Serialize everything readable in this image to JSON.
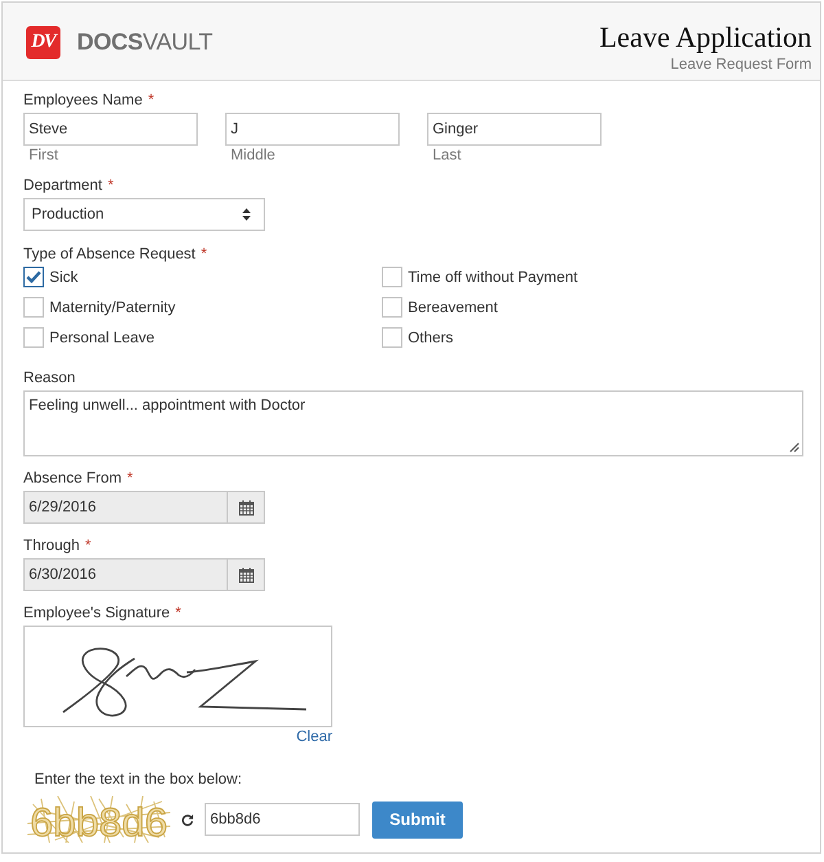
{
  "header": {
    "logo_mark": "DV",
    "logo_name": "**DOCS**VAULT",
    "title": "Leave Application",
    "subtitle": "Leave Request Form"
  },
  "employee_name": {
    "label": "Employees Name",
    "required_mark": "*",
    "parts": [
      {
        "value": "Steve",
        "caption": "First"
      },
      {
        "value": "J",
        "caption": "Middle"
      },
      {
        "value": "Ginger",
        "caption": "Last"
      }
    ]
  },
  "department": {
    "label": "Department",
    "required_mark": "*",
    "value": "Production"
  },
  "absence_type": {
    "label": "Type of Absence Request",
    "required_mark": "*",
    "options": [
      {
        "label": "Sick",
        "checked": true
      },
      {
        "label": "Time off without Payment",
        "checked": false
      },
      {
        "label": "Maternity/Paternity",
        "checked": false
      },
      {
        "label": "Bereavement",
        "checked": false
      },
      {
        "label": "Personal Leave",
        "checked": false
      },
      {
        "label": "Others",
        "checked": false
      }
    ]
  },
  "reason": {
    "label": "Reason",
    "value": "Feeling unwell... appointment with Doctor"
  },
  "dates": [
    {
      "label": "Absence From",
      "required_mark": "*",
      "value": "6/29/2016",
      "disabled": true
    },
    {
      "label": "Through",
      "required_mark": "*",
      "value": "6/30/2016",
      "disabled": true
    }
  ],
  "signature": {
    "label": "Employee's Signature",
    "required_mark": "*",
    "clear_link": "Clear"
  },
  "captcha": {
    "prompt": "Enter the text in the box below:",
    "image_text": "6bb8d6",
    "value": "6bb8d6"
  },
  "submit_button": "Submit"
}
